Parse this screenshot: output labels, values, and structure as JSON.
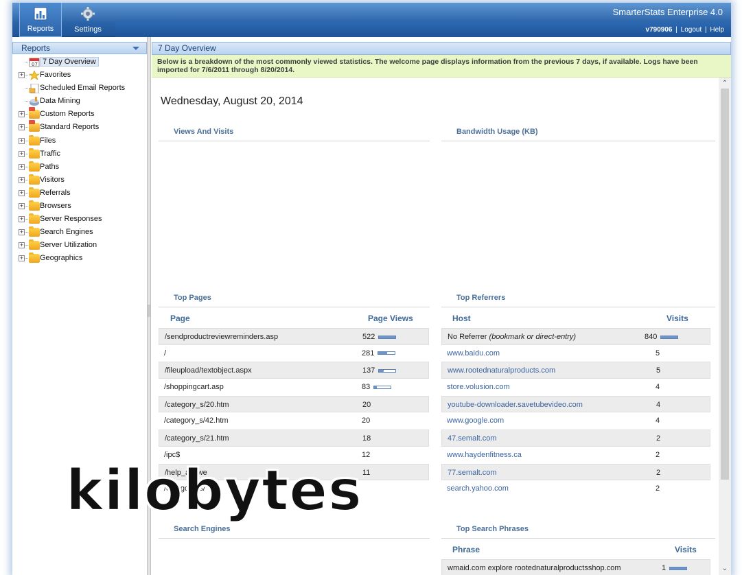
{
  "header": {
    "app_title": "SmarterStats Enterprise 4.0",
    "user": "v790906",
    "logout": "Logout",
    "help": "Help",
    "separator": "|",
    "nav": [
      {
        "label": "Reports",
        "icon": "reports-icon"
      },
      {
        "label": "Settings",
        "icon": "gear-icon"
      }
    ]
  },
  "sidebar": {
    "title": "Reports",
    "items": [
      {
        "label": "7 Day Overview",
        "icon": "calendar-icon",
        "expandable": false,
        "selected": true
      },
      {
        "label": "Favorites",
        "icon": "star-icon",
        "expandable": true
      },
      {
        "label": "Scheduled Email Reports",
        "icon": "scheduled-report-icon",
        "expandable": false
      },
      {
        "label": "Data Mining",
        "icon": "data-mining-icon",
        "expandable": false
      },
      {
        "label": "Custom Reports",
        "icon": "report-folder-icon",
        "expandable": true
      },
      {
        "label": "Standard Reports",
        "icon": "report-folder-icon",
        "expandable": true
      },
      {
        "label": "Files",
        "icon": "folder-icon",
        "expandable": true
      },
      {
        "label": "Traffic",
        "icon": "folder-icon",
        "expandable": true
      },
      {
        "label": "Paths",
        "icon": "folder-icon",
        "expandable": true
      },
      {
        "label": "Visitors",
        "icon": "folder-icon",
        "expandable": true
      },
      {
        "label": "Referrals",
        "icon": "folder-icon",
        "expandable": true
      },
      {
        "label": "Browsers",
        "icon": "folder-icon",
        "expandable": true
      },
      {
        "label": "Server Responses",
        "icon": "folder-icon",
        "expandable": true
      },
      {
        "label": "Search Engines",
        "icon": "folder-icon",
        "expandable": true
      },
      {
        "label": "Server Utilization",
        "icon": "folder-icon",
        "expandable": true
      },
      {
        "label": "Geographics",
        "icon": "folder-icon",
        "expandable": true
      }
    ]
  },
  "main": {
    "title": "7 Day Overview",
    "notice": "Below is a breakdown of the most commonly viewed statistics. The welcome page displays information from the previous 7 days, if available. Logs have been imported for 7/6/2011 through 8/20/2014.",
    "date": "Wednesday, August 20, 2014",
    "sections": {
      "views_visits": "Views And Visits",
      "bandwidth": "Bandwidth Usage (KB)",
      "top_pages": "Top Pages",
      "top_referrers": "Top Referrers",
      "search_engines": "Search Engines",
      "top_search_phrases": "Top Search Phrases"
    },
    "top_pages": {
      "col_page": "Page",
      "col_views": "Page Views",
      "rows": [
        {
          "page": "/sendproductreviewreminders.asp",
          "views": "522",
          "bar": 1.0
        },
        {
          "page": "/",
          "views": "281",
          "bar": 0.54
        },
        {
          "page": "/fileupload/textobject.aspx",
          "views": "137",
          "bar": 0.26
        },
        {
          "page": "/shoppingcart.asp",
          "views": "83",
          "bar": 0.16
        },
        {
          "page": "/category_s/20.htm",
          "views": "20",
          "bar": null
        },
        {
          "page": "/category_s/42.htm",
          "views": "20",
          "bar": null
        },
        {
          "page": "/category_s/21.htm",
          "views": "18",
          "bar": null
        },
        {
          "page": "/ipc$",
          "views": "12",
          "bar": null
        },
        {
          "page": "/help_answe",
          "views": "11",
          "bar": null
        },
        {
          "page": "/category_s/",
          "views": "",
          "bar": null
        }
      ]
    },
    "top_referrers": {
      "col_host": "Host",
      "col_visits": "Visits",
      "rows": [
        {
          "host": "No Referrer",
          "host_note": "(bookmark or direct-entry)",
          "visits": "840",
          "bar": 1.0,
          "link": false
        },
        {
          "host": "www.baidu.com",
          "visits": "5",
          "link": true
        },
        {
          "host": "www.rootednaturalproducts.com",
          "visits": "5",
          "link": true
        },
        {
          "host": "store.volusion.com",
          "visits": "4",
          "link": true
        },
        {
          "host": "youtube-downloader.savetubevideo.com",
          "visits": "4",
          "link": true
        },
        {
          "host": "www.google.com",
          "visits": "4",
          "link": true
        },
        {
          "host": "47.semalt.com",
          "visits": "2",
          "link": true
        },
        {
          "host": "www.haydenfitness.ca",
          "visits": "2",
          "link": true
        },
        {
          "host": "77.semalt.com",
          "visits": "2",
          "link": true
        },
        {
          "host": "search.yahoo.com",
          "visits": "2",
          "link": true
        }
      ]
    },
    "top_search_phrases": {
      "col_phrase": "Phrase",
      "col_visits": "Visits",
      "rows": [
        {
          "phrase": "wmaid.com explore rootednaturalproductsshop.com",
          "visits": "1",
          "bar": 1.0
        }
      ]
    }
  },
  "overlay": {
    "watermark": "kilobytes"
  },
  "colors": {
    "header_blue": "#2b63a8",
    "notice_green": "#e9f6c5",
    "link_blue": "#3a63a0",
    "section_title": "#4a6f99"
  }
}
